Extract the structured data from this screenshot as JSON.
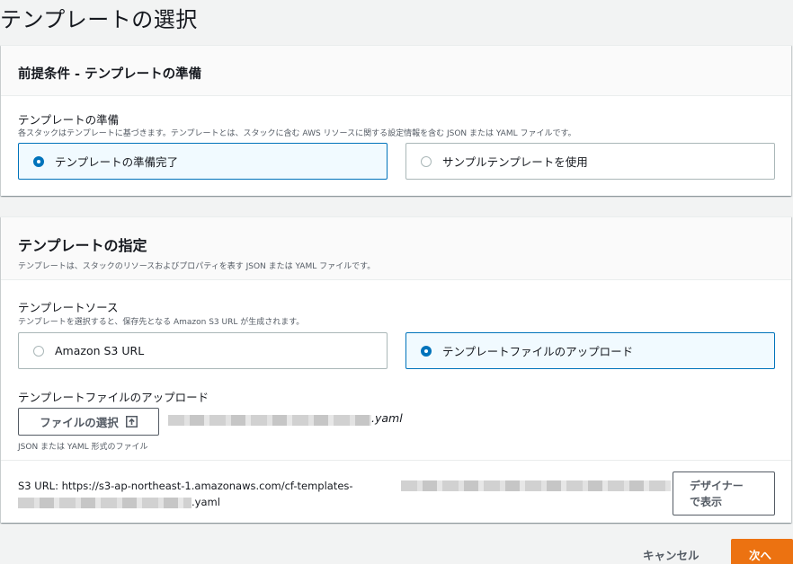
{
  "page": {
    "title": "テンプレートの選択"
  },
  "prerequisite": {
    "heading": "前提条件 - テンプレートの準備",
    "field_label": "テンプレートの準備",
    "field_desc": "各スタックはテンプレートに基づきます。テンプレートとは、スタックに含む AWS リソースに関する設定情報を含む JSON または YAML ファイルです。",
    "options": [
      {
        "label": "テンプレートの準備完了",
        "selected": true
      },
      {
        "label": "サンプルテンプレートを使用",
        "selected": false
      }
    ]
  },
  "specify": {
    "heading": "テンプレートの指定",
    "desc": "テンプレートは、スタックのリソースおよびプロパティを表す JSON または YAML ファイルです。",
    "source_label": "テンプレートソース",
    "source_desc": "テンプレートを選択すると、保存先となる Amazon S3 URL が生成されます。",
    "options": [
      {
        "label": "Amazon S3 URL",
        "selected": false
      },
      {
        "label": "テンプレートファイルのアップロード",
        "selected": true
      }
    ],
    "upload_label": "テンプレートファイルのアップロード",
    "file_button": "ファイルの選択",
    "file_name_suffix": ".yaml",
    "file_hint": "JSON または YAML 形式のファイル",
    "s3_url_label": "S3 URL:",
    "s3_url_value": "https://s3-ap-northeast-1.amazonaws.com/cf-templates-",
    "s3_url_suffix": ".yaml",
    "designer_button_line1": "デザイナー",
    "designer_button_line2": "で表示"
  },
  "footer": {
    "cancel": "キャンセル",
    "next": "次へ"
  },
  "colors": {
    "accent": "#0073bb",
    "primary_button": "#ec7211",
    "selected_tile_bg": "#f1faff"
  }
}
